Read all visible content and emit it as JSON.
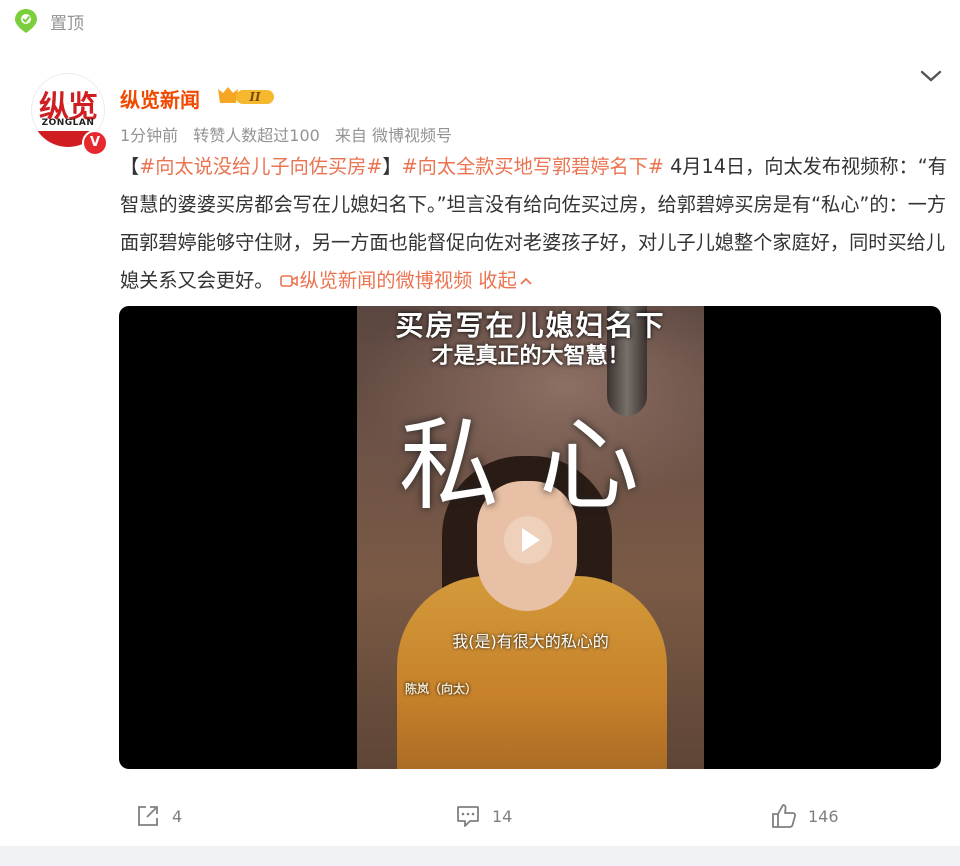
{
  "pin": {
    "label": "置顶"
  },
  "author": {
    "name": "纵览新闻",
    "avatar_text": "纵览",
    "avatar_sub": "ZONGLAN",
    "verified_badge": "V",
    "vip_level": "II"
  },
  "meta": {
    "time": "1分钟前",
    "reposts": "转赞人数超过100",
    "source": "来自 微博视频号"
  },
  "content": {
    "open_bracket": "【",
    "topic1": "#向太说没给儿子向佐买房#",
    "close_bracket": "】",
    "topic2": "#向太全款买地写郭碧婷名下#",
    "body": " 4月14日，向太发布视频称：“有智慧的婆婆买房都会写在儿媳妇名下。”坦言没有给向佐买过房，给郭碧婷买房是有“私心”的：一方面郭碧婷能够守住财，另一方面也能督促向佐对老婆孩子好，对儿子儿媳整个家庭好，同时买给儿媳关系又会更好。 ",
    "video_link": "纵览新闻的微博视频",
    "collapse": "收起"
  },
  "video": {
    "caption_line1": "买房写在儿媳妇名下",
    "caption_line2": "才是真正的大智慧！",
    "overlay_word": "私心",
    "subtitle": "我(是)有很大的私心的",
    "nameplate": "陈岚（向太）"
  },
  "actions": {
    "share_count": "4",
    "comment_count": "14",
    "like_count": "146"
  },
  "colors": {
    "accent": "#eb7350",
    "author": "#f04900",
    "muted": "#939393"
  },
  "icons": [
    "pin-icon",
    "chevron-down-icon",
    "play-icon",
    "video-link-icon",
    "chevron-up-icon",
    "share-icon",
    "comment-icon",
    "like-icon"
  ]
}
